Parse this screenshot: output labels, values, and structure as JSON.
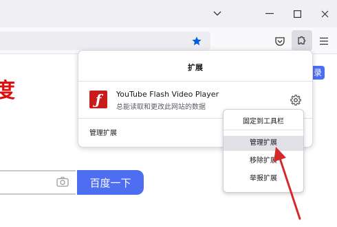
{
  "panel": {
    "title": "扩展",
    "manage_label": "管理扩展",
    "extension": {
      "name": "YouTube Flash Video Player",
      "description": "总能读取和更改此网站的数据",
      "icon": "flash-player-icon"
    }
  },
  "context_menu": {
    "items": [
      "固定到工具栏",
      "管理扩展",
      "移除扩展",
      "举报扩展"
    ],
    "highlighted": "管理扩展"
  },
  "page": {
    "red_char": "度",
    "blue_tag": "录",
    "search_button": "百度一下"
  },
  "colors": {
    "accent_blue": "#4e6ef2",
    "flash_red": "#c81b1b",
    "arrow_red": "#d42a2a"
  }
}
